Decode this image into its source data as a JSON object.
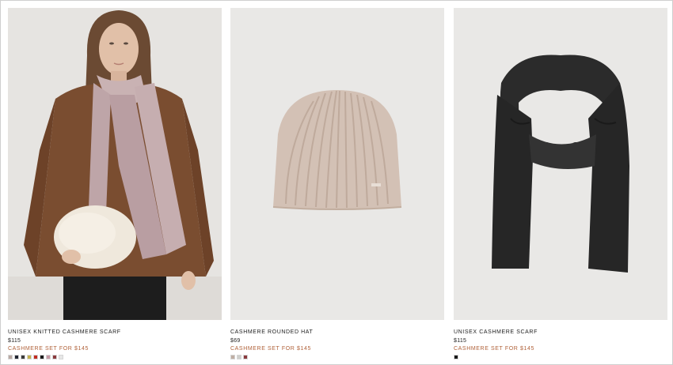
{
  "products": [
    {
      "title": "UNISEX KNITTED CASHMERE SCARF",
      "price": "$115",
      "promo": "CASHMERE SET FOR $145",
      "image": "model-wearing-pink-cashmere-scarf",
      "swatches": [
        "#b9a9a3",
        "#1f2330",
        "#3a3a3a",
        "#c4b24f",
        "#c22a1f",
        "#1a1a1a",
        "#c79aa6",
        "#8a3a3e",
        "#e6e6e6"
      ]
    },
    {
      "title": "CASHMERE ROUNDED HAT",
      "price": "$69",
      "promo": "CASHMERE SET FOR $145",
      "image": "beige-ribbed-cashmere-hat",
      "swatches": [
        "#bfaea3",
        "#cfcfcc",
        "#8a3a3e"
      ]
    },
    {
      "title": "UNISEX CASHMERE SCARF",
      "price": "$115",
      "promo": "CASHMERE SET FOR $145",
      "image": "black-cashmere-scarf",
      "swatches": [
        "#1a1a1a"
      ]
    }
  ],
  "colors": {
    "promo": "#b0623a",
    "background": "#ffffff",
    "image_bg": "#e9e8e6"
  }
}
